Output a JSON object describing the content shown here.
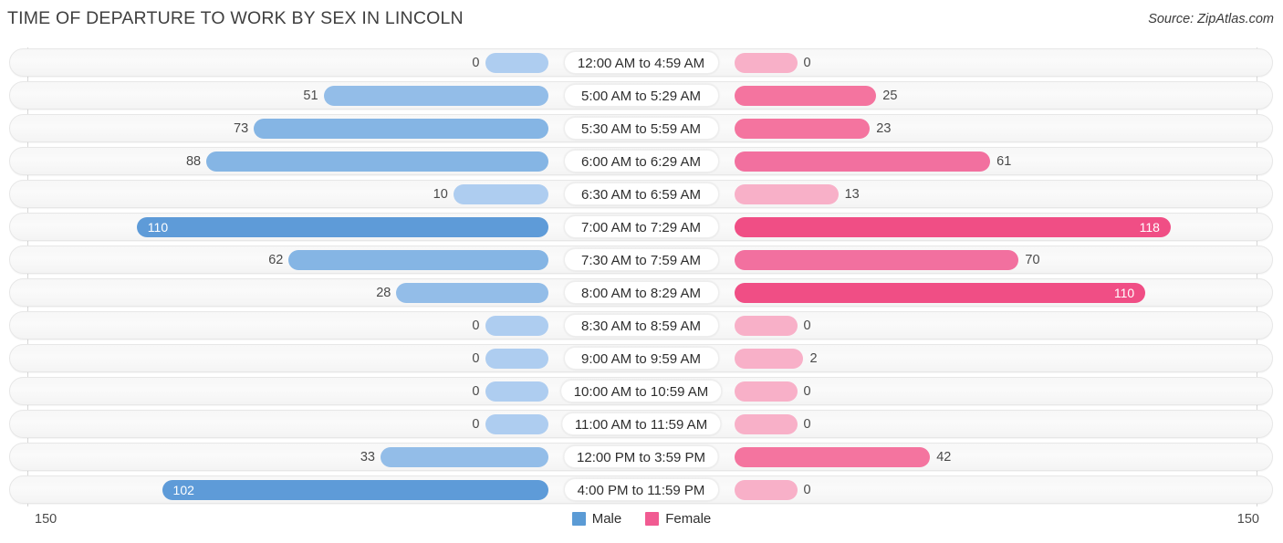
{
  "header": {
    "title": "TIME OF DEPARTURE TO WORK BY SEX IN LINCOLN",
    "source": "Source: ZipAtlas.com"
  },
  "axis": {
    "left_max_label": "150",
    "right_max_label": "150"
  },
  "legend": {
    "items": [
      {
        "label": "Male",
        "color": "#5b9bd5"
      },
      {
        "label": "Female",
        "color": "#f15b92"
      }
    ]
  },
  "colors": {
    "male_dark": "#5e9bd8",
    "male_mid": "#85b5e4",
    "male_light": "#aecdf0",
    "female_dark": "#f04e85",
    "female_mid": "#f2709f",
    "female_light": "#f8b0c8",
    "track": "#f7f7f7",
    "axis": "#d7d7d7"
  },
  "chart_data": {
    "type": "bar",
    "orientation": "horizontal-diverging",
    "title": "TIME OF DEPARTURE TO WORK BY SEX IN LINCOLN",
    "xlabel": "",
    "ylabel": "",
    "xlim": [
      150,
      150
    ],
    "grid": false,
    "legend_position": "bottom-center",
    "categories": [
      "12:00 AM to 4:59 AM",
      "5:00 AM to 5:29 AM",
      "5:30 AM to 5:59 AM",
      "6:00 AM to 6:29 AM",
      "6:30 AM to 6:59 AM",
      "7:00 AM to 7:29 AM",
      "7:30 AM to 7:59 AM",
      "8:00 AM to 8:29 AM",
      "8:30 AM to 8:59 AM",
      "9:00 AM to 9:59 AM",
      "10:00 AM to 10:59 AM",
      "11:00 AM to 11:59 AM",
      "12:00 PM to 3:59 PM",
      "4:00 PM to 11:59 PM"
    ],
    "series": [
      {
        "name": "Male",
        "values": [
          0,
          51,
          73,
          88,
          10,
          110,
          62,
          28,
          0,
          0,
          0,
          0,
          33,
          102
        ]
      },
      {
        "name": "Female",
        "values": [
          0,
          25,
          23,
          61,
          13,
          118,
          70,
          110,
          0,
          2,
          0,
          0,
          42,
          0
        ]
      }
    ]
  },
  "rows": [
    {
      "label": "12:00 AM to 4:59 AM",
      "male": "0",
      "female": "0"
    },
    {
      "label": "5:00 AM to 5:29 AM",
      "male": "51",
      "female": "25"
    },
    {
      "label": "5:30 AM to 5:59 AM",
      "male": "73",
      "female": "23"
    },
    {
      "label": "6:00 AM to 6:29 AM",
      "male": "88",
      "female": "61"
    },
    {
      "label": "6:30 AM to 6:59 AM",
      "male": "10",
      "female": "13"
    },
    {
      "label": "7:00 AM to 7:29 AM",
      "male": "110",
      "female": "118"
    },
    {
      "label": "7:30 AM to 7:59 AM",
      "male": "62",
      "female": "70"
    },
    {
      "label": "8:00 AM to 8:29 AM",
      "male": "28",
      "female": "110"
    },
    {
      "label": "8:30 AM to 8:59 AM",
      "male": "0",
      "female": "0"
    },
    {
      "label": "9:00 AM to 9:59 AM",
      "male": "0",
      "female": "2"
    },
    {
      "label": "10:00 AM to 10:59 AM",
      "male": "0",
      "female": "0"
    },
    {
      "label": "11:00 AM to 11:59 AM",
      "male": "0",
      "female": "0"
    },
    {
      "label": "12:00 PM to 3:59 PM",
      "male": "33",
      "female": "42"
    },
    {
      "label": "4:00 PM to 11:59 PM",
      "male": "102",
      "female": "0"
    }
  ]
}
